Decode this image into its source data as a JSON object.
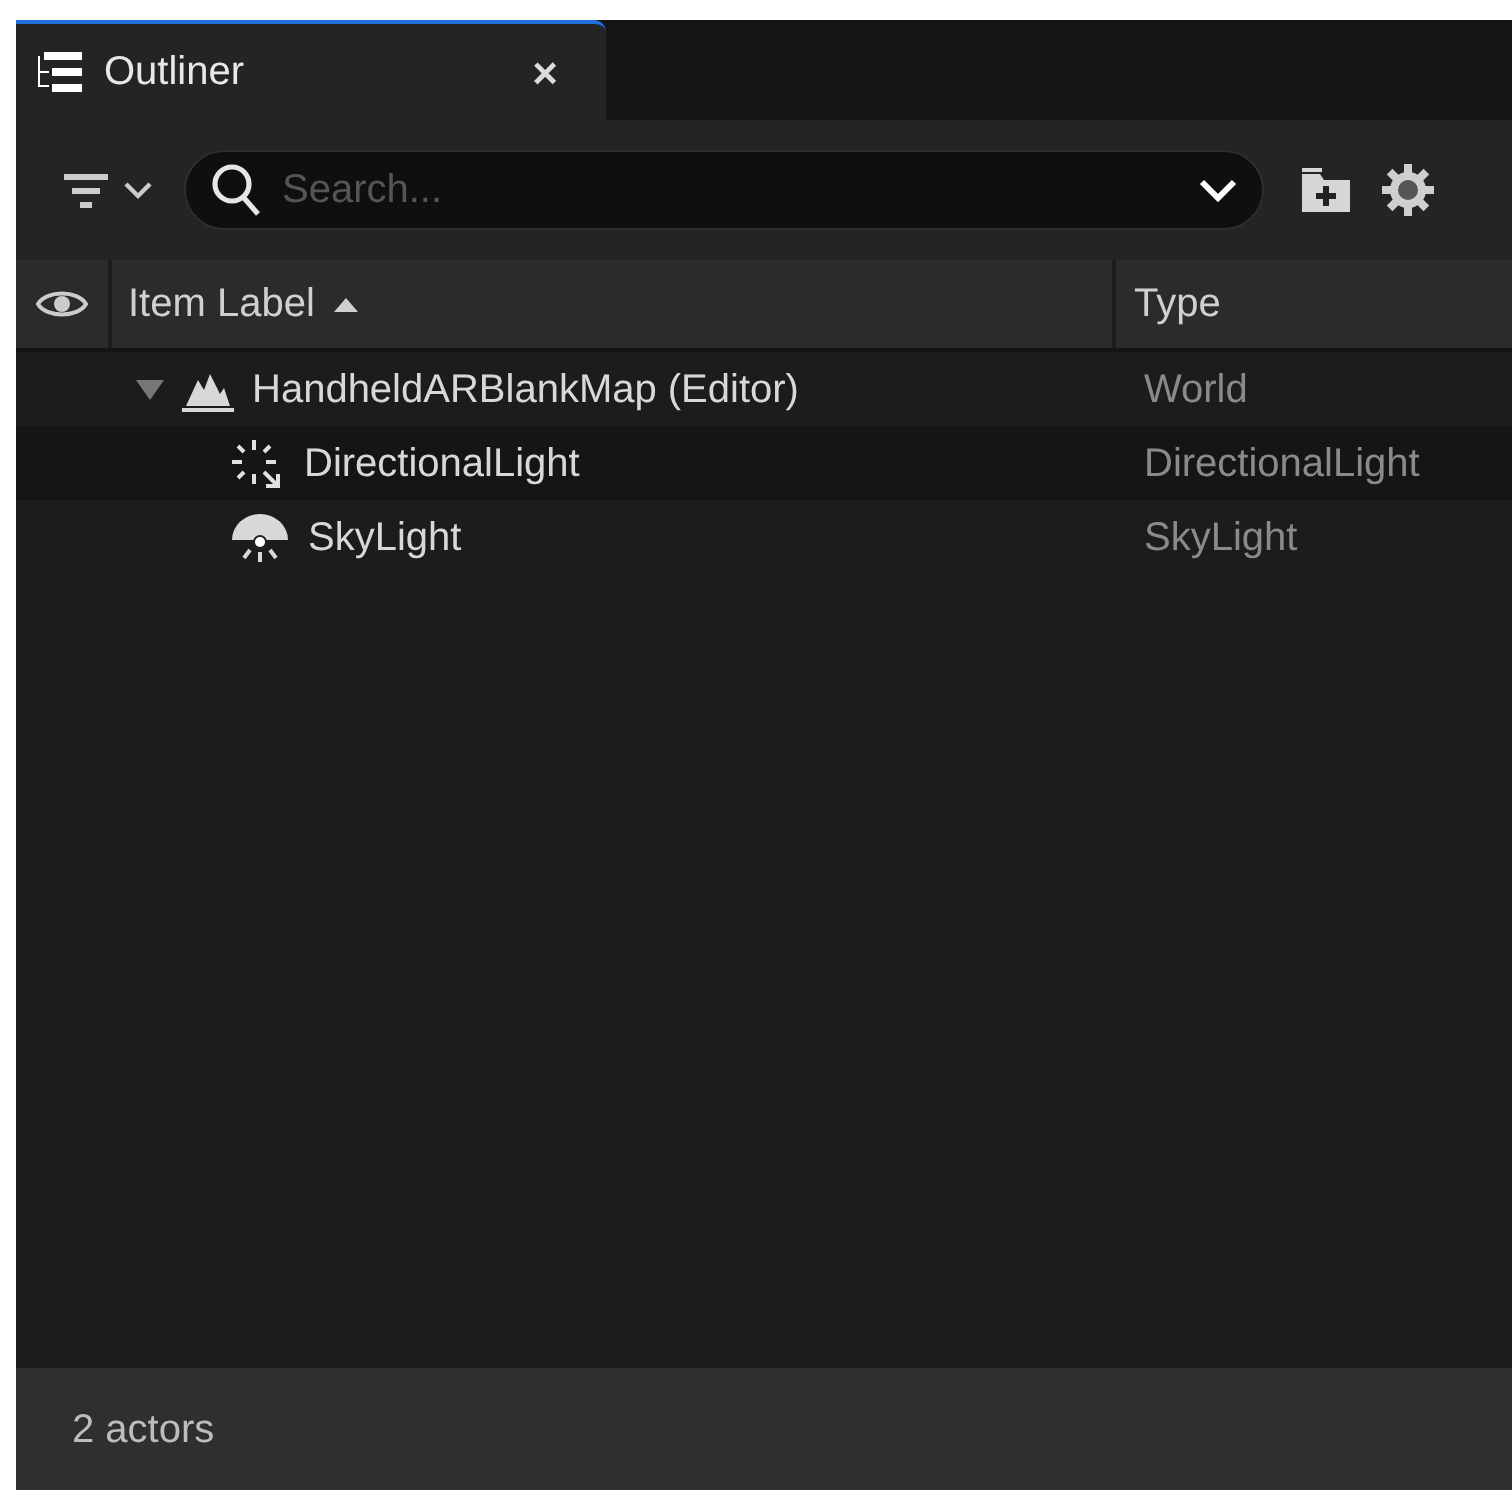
{
  "tab": {
    "title": "Outliner",
    "close": "×",
    "selected": true
  },
  "toolbar": {
    "search": {
      "placeholder": "Search..."
    }
  },
  "table": {
    "columns": [
      {
        "label": "Item Label",
        "sorted_ascending": true
      },
      {
        "label": "Type"
      }
    ],
    "rows": [
      {
        "label": "HandheldARBlankMap (Editor)",
        "type": "World",
        "kind": "world",
        "expanded": true,
        "children": [
          {
            "label": "DirectionalLight",
            "type": "DirectionalLight",
            "kind": "directional_light"
          },
          {
            "label": "SkyLight",
            "type": "SkyLight",
            "kind": "sky_light"
          }
        ]
      }
    ]
  },
  "status_bar": "2 actors"
}
